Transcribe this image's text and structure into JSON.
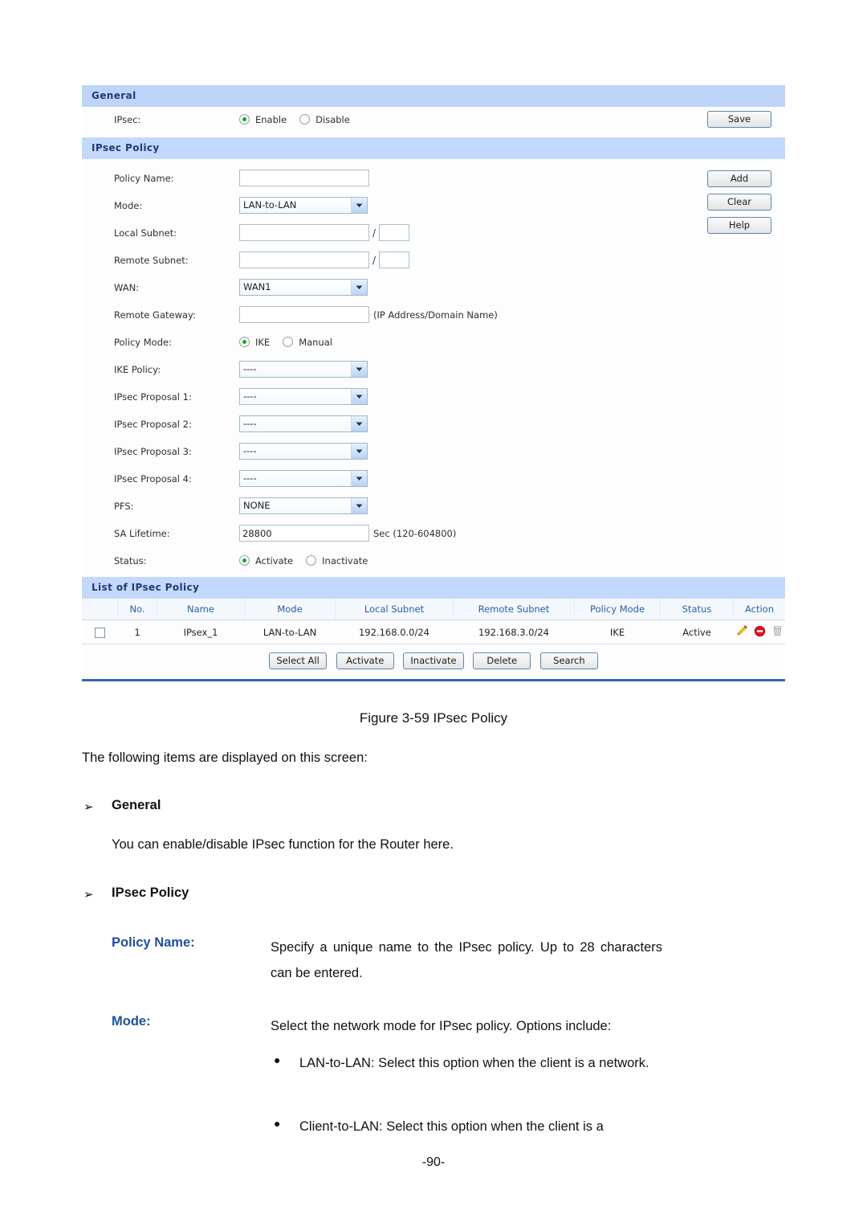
{
  "screenshot": {
    "general": {
      "header": "General",
      "ipsec_label": "IPsec:",
      "enable_label": "Enable",
      "disable_label": "Disable",
      "selected": "Enable",
      "save_label": "Save"
    },
    "ipsec_policy": {
      "header": "IPsec Policy",
      "fields": {
        "policy_name_label": "Policy Name:",
        "policy_name_value": "",
        "mode_label": "Mode:",
        "mode_value": "LAN-to-LAN",
        "local_subnet_label": "Local Subnet:",
        "local_subnet_value": "",
        "local_subnet_mask": "",
        "remote_subnet_label": "Remote Subnet:",
        "remote_subnet_value": "",
        "remote_subnet_mask": "",
        "wan_label": "WAN:",
        "wan_value": "WAN1",
        "remote_gateway_label": "Remote Gateway:",
        "remote_gateway_value": "",
        "remote_gateway_hint": "(IP Address/Domain Name)",
        "policy_mode_label": "Policy Mode:",
        "policy_mode_ike": "IKE",
        "policy_mode_manual": "Manual",
        "policy_mode_selected": "IKE",
        "ike_policy_label": "IKE Policy:",
        "ike_policy_value": "----",
        "proposal1_label": "IPsec Proposal 1:",
        "proposal1_value": "----",
        "proposal2_label": "IPsec Proposal 2:",
        "proposal2_value": "----",
        "proposal3_label": "IPsec Proposal 3:",
        "proposal3_value": "----",
        "proposal4_label": "IPsec Proposal 4:",
        "proposal4_value": "----",
        "pfs_label": "PFS:",
        "pfs_value": "NONE",
        "sa_lifetime_label": "SA Lifetime:",
        "sa_lifetime_value": "28800",
        "sa_lifetime_hint": "Sec (120-604800)",
        "status_label": "Status:",
        "status_activate": "Activate",
        "status_inactivate": "Inactivate",
        "status_selected": "Activate"
      },
      "buttons": {
        "add_label": "Add",
        "clear_label": "Clear",
        "help_label": "Help"
      }
    },
    "list": {
      "header": "List of IPsec Policy",
      "columns": [
        "No.",
        "Name",
        "Mode",
        "Local Subnet",
        "Remote Subnet",
        "Policy Mode",
        "Status",
        "Action"
      ],
      "rows": [
        {
          "no": "1",
          "name": "IPsex_1",
          "mode": "LAN-to-LAN",
          "local_subnet": "192.168.0.0/24",
          "remote_subnet": "192.168.3.0/24",
          "policy_mode": "IKE",
          "status": "Active",
          "actions": [
            "pencil-icon",
            "forbid-icon",
            "trash-icon"
          ]
        }
      ],
      "buttons": {
        "select_all": "Select All",
        "activate": "Activate",
        "inactivate": "Inactivate",
        "delete": "Delete",
        "search": "Search"
      }
    },
    "colors": {
      "section_bar_bg": "#c4d8fb",
      "section_bar_text": "#1f3c73",
      "table_header_text": "#2a5ea5",
      "panel_bottom_rule": "#2f6aa8",
      "radio_on_dot": "#17a81a"
    }
  },
  "document": {
    "figure_caption": "Figure 3-59 IPsec Policy",
    "intro": "The following items are displayed on this screen:",
    "sections": [
      {
        "arrow": "➢",
        "heading": "General",
        "body": "You can enable/disable IPsec function for the Router here."
      },
      {
        "arrow": "➢",
        "heading": "IPsec Policy"
      }
    ],
    "terms": [
      {
        "term": "Policy Name:",
        "definition": "Specify a unique name to the IPsec policy. Up to 28 characters can be entered."
      },
      {
        "term": "Mode:",
        "definition": "Select the network mode for IPsec policy. Options include:",
        "bullets": [
          "LAN-to-LAN: Select this option when the client is a network.",
          "Client-to-LAN: Select this option when the client is a"
        ]
      }
    ],
    "page_number": "-90-"
  }
}
